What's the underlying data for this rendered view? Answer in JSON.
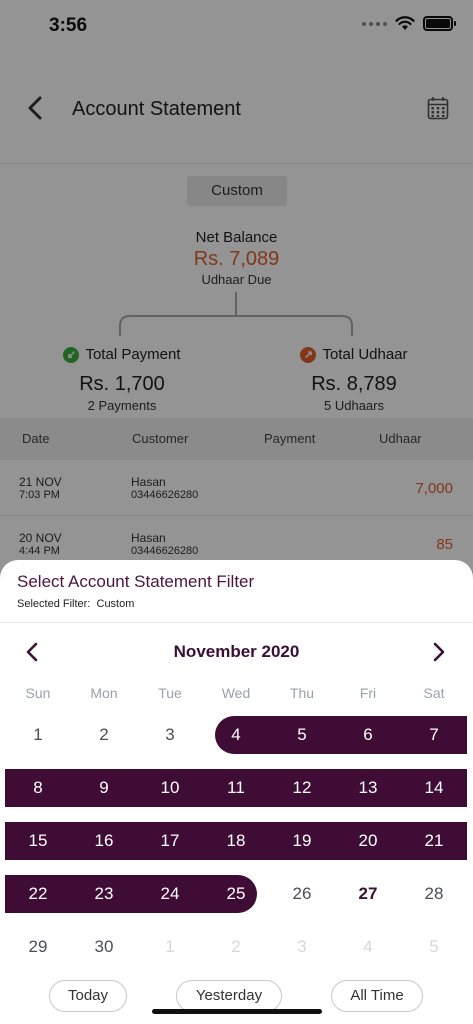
{
  "status_bar": {
    "time": "3:56"
  },
  "header": {
    "title": "Account Statement"
  },
  "filter_pill": "Custom",
  "summary": {
    "net_label": "Net Balance",
    "net_amount": "Rs. 7,089",
    "net_sub": "Udhaar Due",
    "payment": {
      "label": "Total Payment",
      "amount": "Rs. 1,700",
      "count": "2 Payments"
    },
    "udhaar": {
      "label": "Total Udhaar",
      "amount": "Rs. 8,789",
      "count": "5 Udhaars"
    }
  },
  "table": {
    "headers": [
      "Date",
      "Customer",
      "Payment",
      "Udhaar"
    ],
    "rows": [
      {
        "date": "21 NOV",
        "time": "7:03 PM",
        "name": "Hasan",
        "phone": "03446626280",
        "udhaar": "7,000"
      },
      {
        "date": "20 NOV",
        "time": "4:44 PM",
        "name": "Hasan",
        "phone": "03446626280",
        "udhaar": "85"
      }
    ]
  },
  "sheet": {
    "title": "Select Account Statement Filter",
    "selected_label": "Selected Filter:",
    "selected_value": "Custom",
    "month": "November 2020",
    "weekdays": [
      "Sun",
      "Mon",
      "Tue",
      "Wed",
      "Thu",
      "Fri",
      "Sat"
    ],
    "weeks": [
      [
        "1",
        "2",
        "3",
        "4",
        "5",
        "6",
        "7"
      ],
      [
        "8",
        "9",
        "10",
        "11",
        "12",
        "13",
        "14"
      ],
      [
        "15",
        "16",
        "17",
        "18",
        "19",
        "20",
        "21"
      ],
      [
        "22",
        "23",
        "24",
        "25",
        "26",
        "27",
        "28"
      ],
      [
        "29",
        "30",
        "1",
        "2",
        "3",
        "4",
        "5"
      ]
    ],
    "range_start": "4",
    "range_end": "25",
    "today": "27",
    "quick_buttons": [
      "Today",
      "Yesterday",
      "All Time"
    ]
  },
  "colors": {
    "accent": "#3f0c36",
    "udhaar": "#e0602e",
    "payment_icon": "#3cae3c",
    "udhaar_icon": "#e0602e"
  }
}
